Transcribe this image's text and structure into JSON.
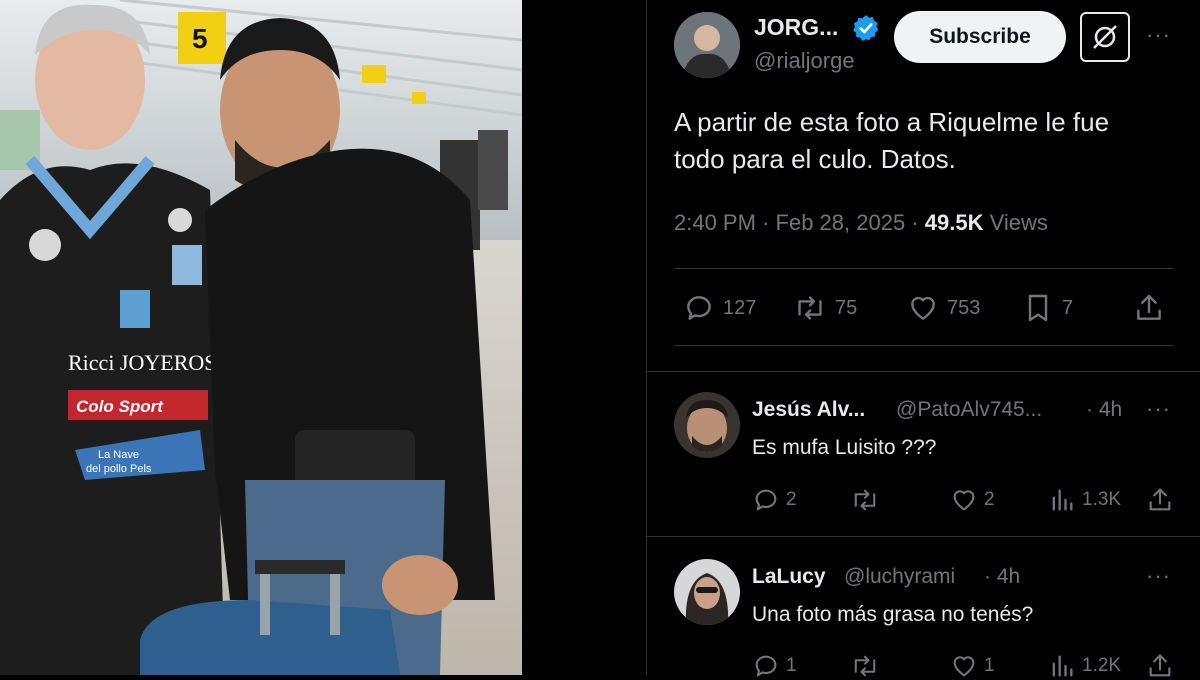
{
  "tweet": {
    "author_name": "JORG...",
    "author_handle": "@rialjorge",
    "subscribe_label": "Subscribe",
    "text_line1": "A partir de esta foto a Riquelme le fue",
    "text_line2": "todo para el culo. Datos.",
    "time": "2:40 PM",
    "date": "Feb 28, 2025",
    "views_count": "49.5K",
    "views_label": "Views",
    "replies": "127",
    "reposts": "75",
    "likes": "753",
    "bookmarks": "7"
  },
  "replies": [
    {
      "name": "Jesús Alv...",
      "handle": "@PatoAlv745...",
      "age": "· 4h",
      "text": "Es mufa Luisito ???",
      "replies": "2",
      "likes": "2",
      "views": "1.3K"
    },
    {
      "name": "LaLucy",
      "handle": "@luchyrami",
      "age": "· 4h",
      "text": "Una foto más grasa no tenés?",
      "replies": "1",
      "likes": "1",
      "views": "1.2K"
    }
  ],
  "photo": {
    "gate_sign": "5",
    "sponsor1": "Ricci JOYEROS",
    "sponsor2": "Colo Sport",
    "sponsor3_line1": "La Nave",
    "sponsor3_line2": "del pollo Pels"
  },
  "colors": {
    "verified": "#1d9bf0",
    "muted": "#71767b",
    "text": "#e7e9ea"
  }
}
